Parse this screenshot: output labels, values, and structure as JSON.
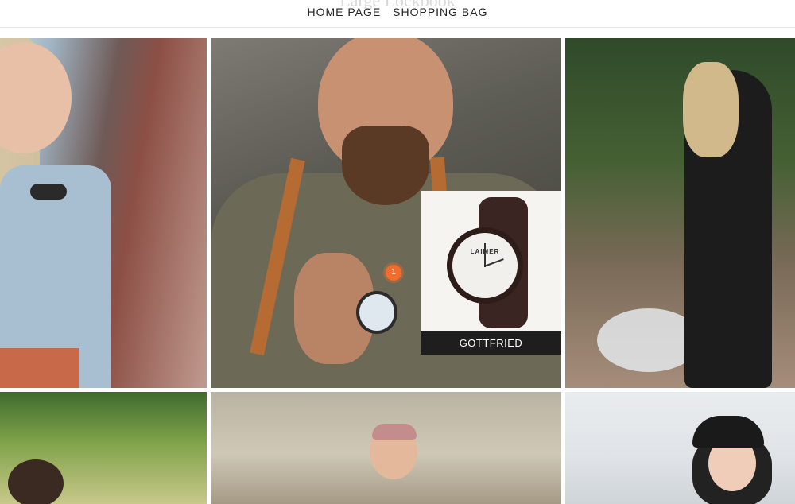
{
  "header": {
    "ghost_title": "Large Lockbook",
    "nav": [
      {
        "label": "HOME PAGE"
      },
      {
        "label": "SHOPPING BAG"
      }
    ]
  },
  "lookbook": {
    "tiles": [
      {
        "alt": "woman-watch-photo"
      },
      {
        "alt": "man-leather-suspenders-photo"
      },
      {
        "alt": "woman-hillside-photo"
      },
      {
        "alt": "woman-plants-photo"
      },
      {
        "alt": "woman-headband-photo"
      },
      {
        "alt": "woman-cap-photo"
      }
    ],
    "hotspot": {
      "number": "1",
      "color": "#f36c2c"
    },
    "product_popup": {
      "brand": "LAIMER",
      "name": "GOTTFRIED"
    }
  }
}
